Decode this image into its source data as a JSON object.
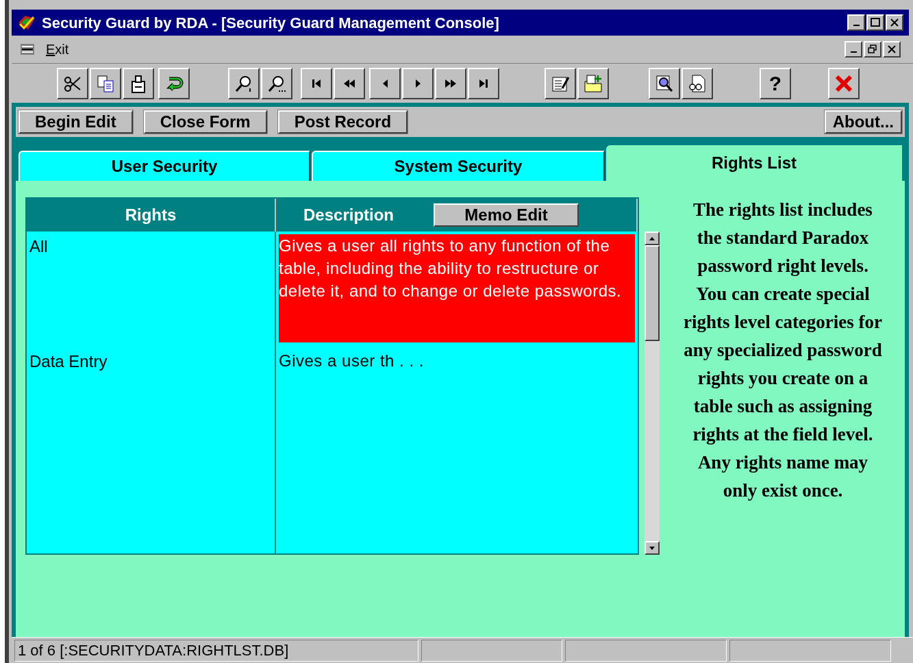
{
  "window": {
    "title": "Security Guard by RDA - [Security Guard Management Console]"
  },
  "menu": [
    {
      "label": "Exit"
    }
  ],
  "toolbar": {
    "help_label": "?"
  },
  "form_buttons": [
    "Begin Edit",
    "Close Form",
    "Post Record"
  ],
  "about_button": "About...",
  "tabs": [
    {
      "label": "User Security",
      "selected": false
    },
    {
      "label": "System Security",
      "selected": false
    },
    {
      "label": "Rights List",
      "selected": true
    }
  ],
  "grid": {
    "columns": [
      "Rights",
      "Description"
    ],
    "memo_button": "Memo Edit",
    "rows": [
      {
        "right": "All",
        "description": "Gives a user all rights to any function of the table, including the ability to restructure or delete it, and to change or delete passwords.",
        "selected": true
      },
      {
        "right": "Data Entry",
        "description": "Gives a user th . . .",
        "selected": false
      }
    ]
  },
  "info_text": "The rights list includes the standard Paradox password right levels. You can create special rights level categories for any specialized password rights you create on a table such as assigning rights at the field level. Any rights name may only exist once.",
  "status_bar": [
    "1 of 6 [:SECURITYDATA:RIGHTLST.DB]"
  ]
}
